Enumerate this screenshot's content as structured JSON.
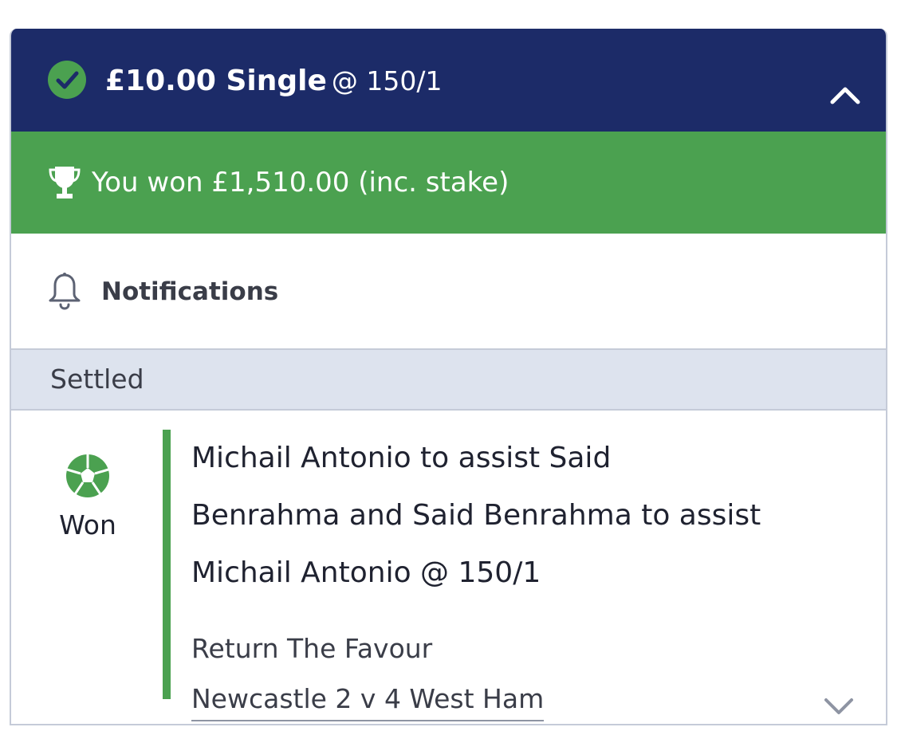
{
  "bet": {
    "stake": "£10.00 Single",
    "odds": "@ 150/1",
    "status_icon": "check-circle-icon",
    "collapse_icon": "chevron-up-icon"
  },
  "result_banner": {
    "icon": "trophy-icon",
    "text": "You won £1,510.00 (inc. stake)"
  },
  "notifications": {
    "icon": "bell-icon",
    "label": "Notifications"
  },
  "section": {
    "label": "Settled"
  },
  "selection": {
    "sport_icon": "football-icon",
    "result": "Won",
    "description": "Michail Antonio to assist Said Benrahma and Said Benrahma to assist Michail Antonio @ 150/1",
    "market": "Return The Favour",
    "event": "Newcastle 2 v 4 West Ham",
    "expand_icon": "chevron-down-icon"
  },
  "colors": {
    "header_bg": "#1c2b68",
    "won_green": "#4ba150",
    "settled_bg": "#dde3ee"
  }
}
